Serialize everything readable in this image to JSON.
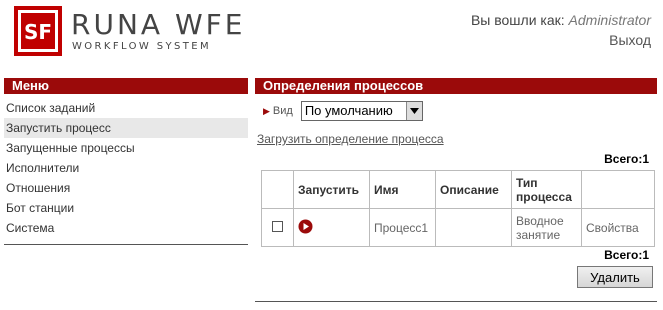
{
  "header": {
    "logo_text": "RUNA WFE",
    "logo_subtext": "WORKFLOW SYSTEM",
    "logo_mark_text": "SF",
    "logged_in_label": "Вы вошли как:",
    "user": "Administrator",
    "logout_label": "Выход"
  },
  "menu": {
    "title": "Меню",
    "items": [
      {
        "label": "Список заданий"
      },
      {
        "label": "Запустить процесс"
      },
      {
        "label": "Запущенные процессы"
      },
      {
        "label": "Исполнители"
      },
      {
        "label": "Отношения"
      },
      {
        "label": "Бот станции"
      },
      {
        "label": "Система"
      }
    ],
    "active_index": 1
  },
  "main": {
    "title": "Определения процессов",
    "view_label": "Вид",
    "view_select_value": "По умолчанию",
    "upload_label": "Загрузить определение процесса",
    "total_label": "Всего:1",
    "table": {
      "headers": [
        "",
        "Запустить",
        "Имя",
        "Описание",
        "Тип процесса",
        ""
      ],
      "rows": [
        {
          "name": "Процесс1",
          "description": "",
          "type": "Вводное занятие",
          "properties": "Свойства"
        }
      ]
    },
    "delete_label": "Удалить"
  },
  "colors": {
    "accent": "#9b0a0a",
    "active_row_bg": "#e8e8e8"
  }
}
